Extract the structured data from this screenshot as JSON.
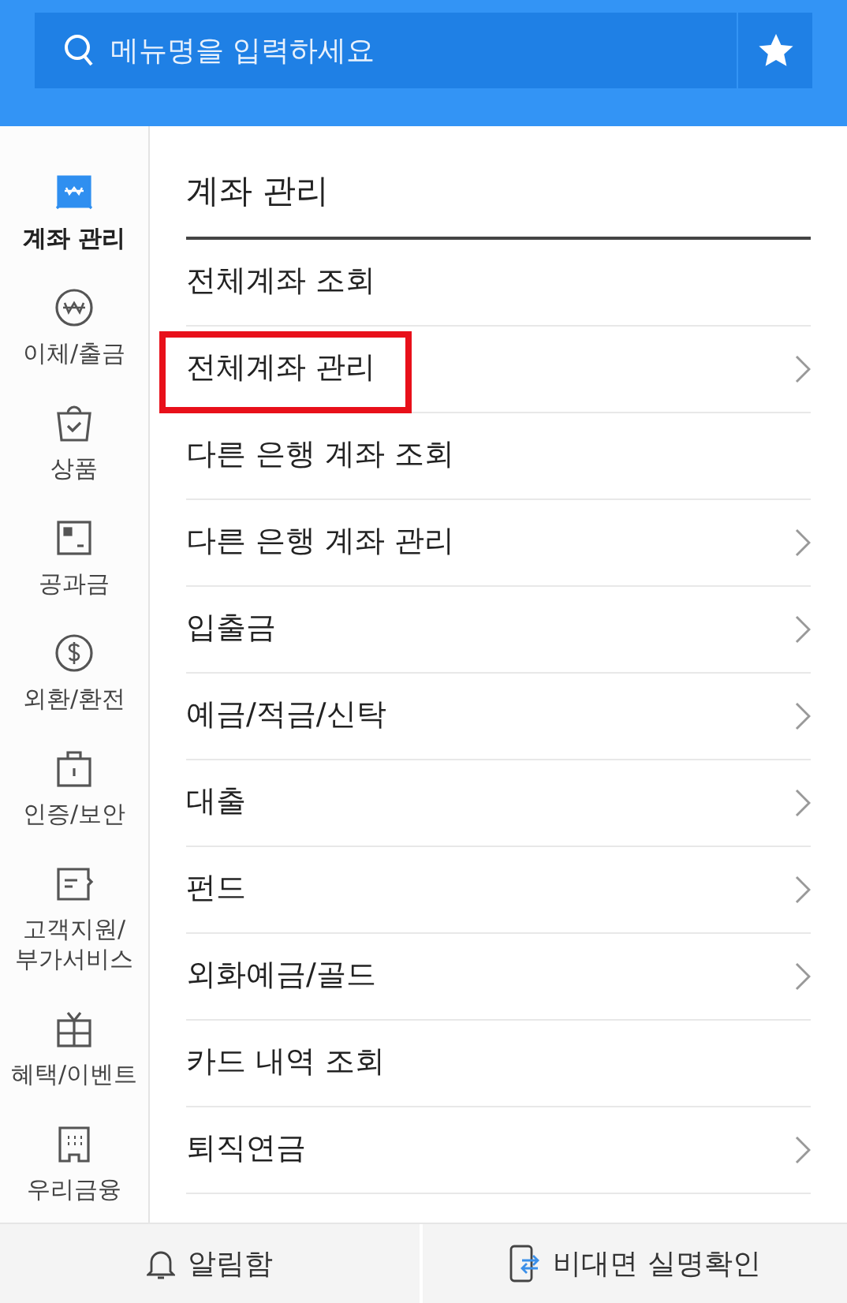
{
  "search": {
    "placeholder": "메뉴명을 입력하세요"
  },
  "sidebar": {
    "items": [
      {
        "label": "계좌 관리",
        "selected": true
      },
      {
        "label": "이체/출금",
        "selected": false
      },
      {
        "label": "상품",
        "selected": false
      },
      {
        "label": "공과금",
        "selected": false
      },
      {
        "label": "외환/환전",
        "selected": false
      },
      {
        "label": "인증/보안",
        "selected": false
      },
      {
        "label": "고객지원/\n부가서비스",
        "selected": false
      },
      {
        "label": "혜택/이벤트",
        "selected": false
      },
      {
        "label": "우리금융",
        "selected": false
      }
    ]
  },
  "menu": {
    "title": "계좌 관리",
    "items": [
      {
        "label": "전체계좌 조회",
        "has_arrow": false,
        "highlighted": false
      },
      {
        "label": "전체계좌 관리",
        "has_arrow": true,
        "highlighted": true
      },
      {
        "label": "다른 은행 계좌 조회",
        "has_arrow": false,
        "highlighted": false
      },
      {
        "label": "다른 은행 계좌 관리",
        "has_arrow": true,
        "highlighted": false
      },
      {
        "label": "입출금",
        "has_arrow": true,
        "highlighted": false
      },
      {
        "label": "예금/적금/신탁",
        "has_arrow": true,
        "highlighted": false
      },
      {
        "label": "대출",
        "has_arrow": true,
        "highlighted": false
      },
      {
        "label": "펀드",
        "has_arrow": true,
        "highlighted": false
      },
      {
        "label": "외화예금/골드",
        "has_arrow": true,
        "highlighted": false
      },
      {
        "label": "카드 내역 조회",
        "has_arrow": false,
        "highlighted": false
      },
      {
        "label": "퇴직연금",
        "has_arrow": true,
        "highlighted": false
      }
    ]
  },
  "bottom_bar": {
    "buttons": [
      {
        "label": "알림함"
      },
      {
        "label": "비대면 실명확인"
      }
    ]
  }
}
